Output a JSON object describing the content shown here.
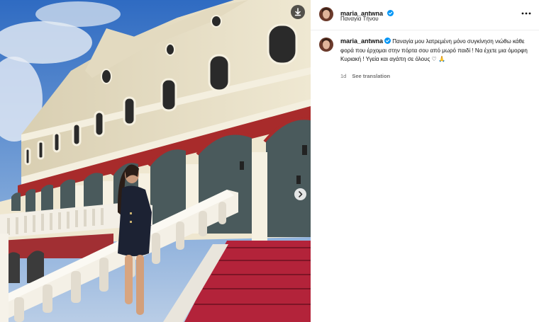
{
  "post": {
    "username": "maria_antwna",
    "location": "Παναγία Τήνου",
    "caption_user": "maria_antwna",
    "caption_text": "Παναγία μου λατρεμένη μόνο συγκίνηση νιώθω κάθε φορά που έρχομαι στην πόρτα σου από μωρό παιδί ! Να έχετε μια όμορφη Κυριακή ! Υγεία και αγάπη σε όλους ♡ 🙏",
    "time_ago": "1d",
    "see_translation": "See translation"
  },
  "icons": {
    "download": "download-icon",
    "next": "chevron-right-icon",
    "more": "more-options-icon",
    "verified": "verified-badge-icon"
  },
  "colors": {
    "verified": "#0095f6",
    "text": "#111111",
    "secondary": "#737373",
    "stairs_red": "#b3233a",
    "facade_cream": "#ebe3c9"
  }
}
